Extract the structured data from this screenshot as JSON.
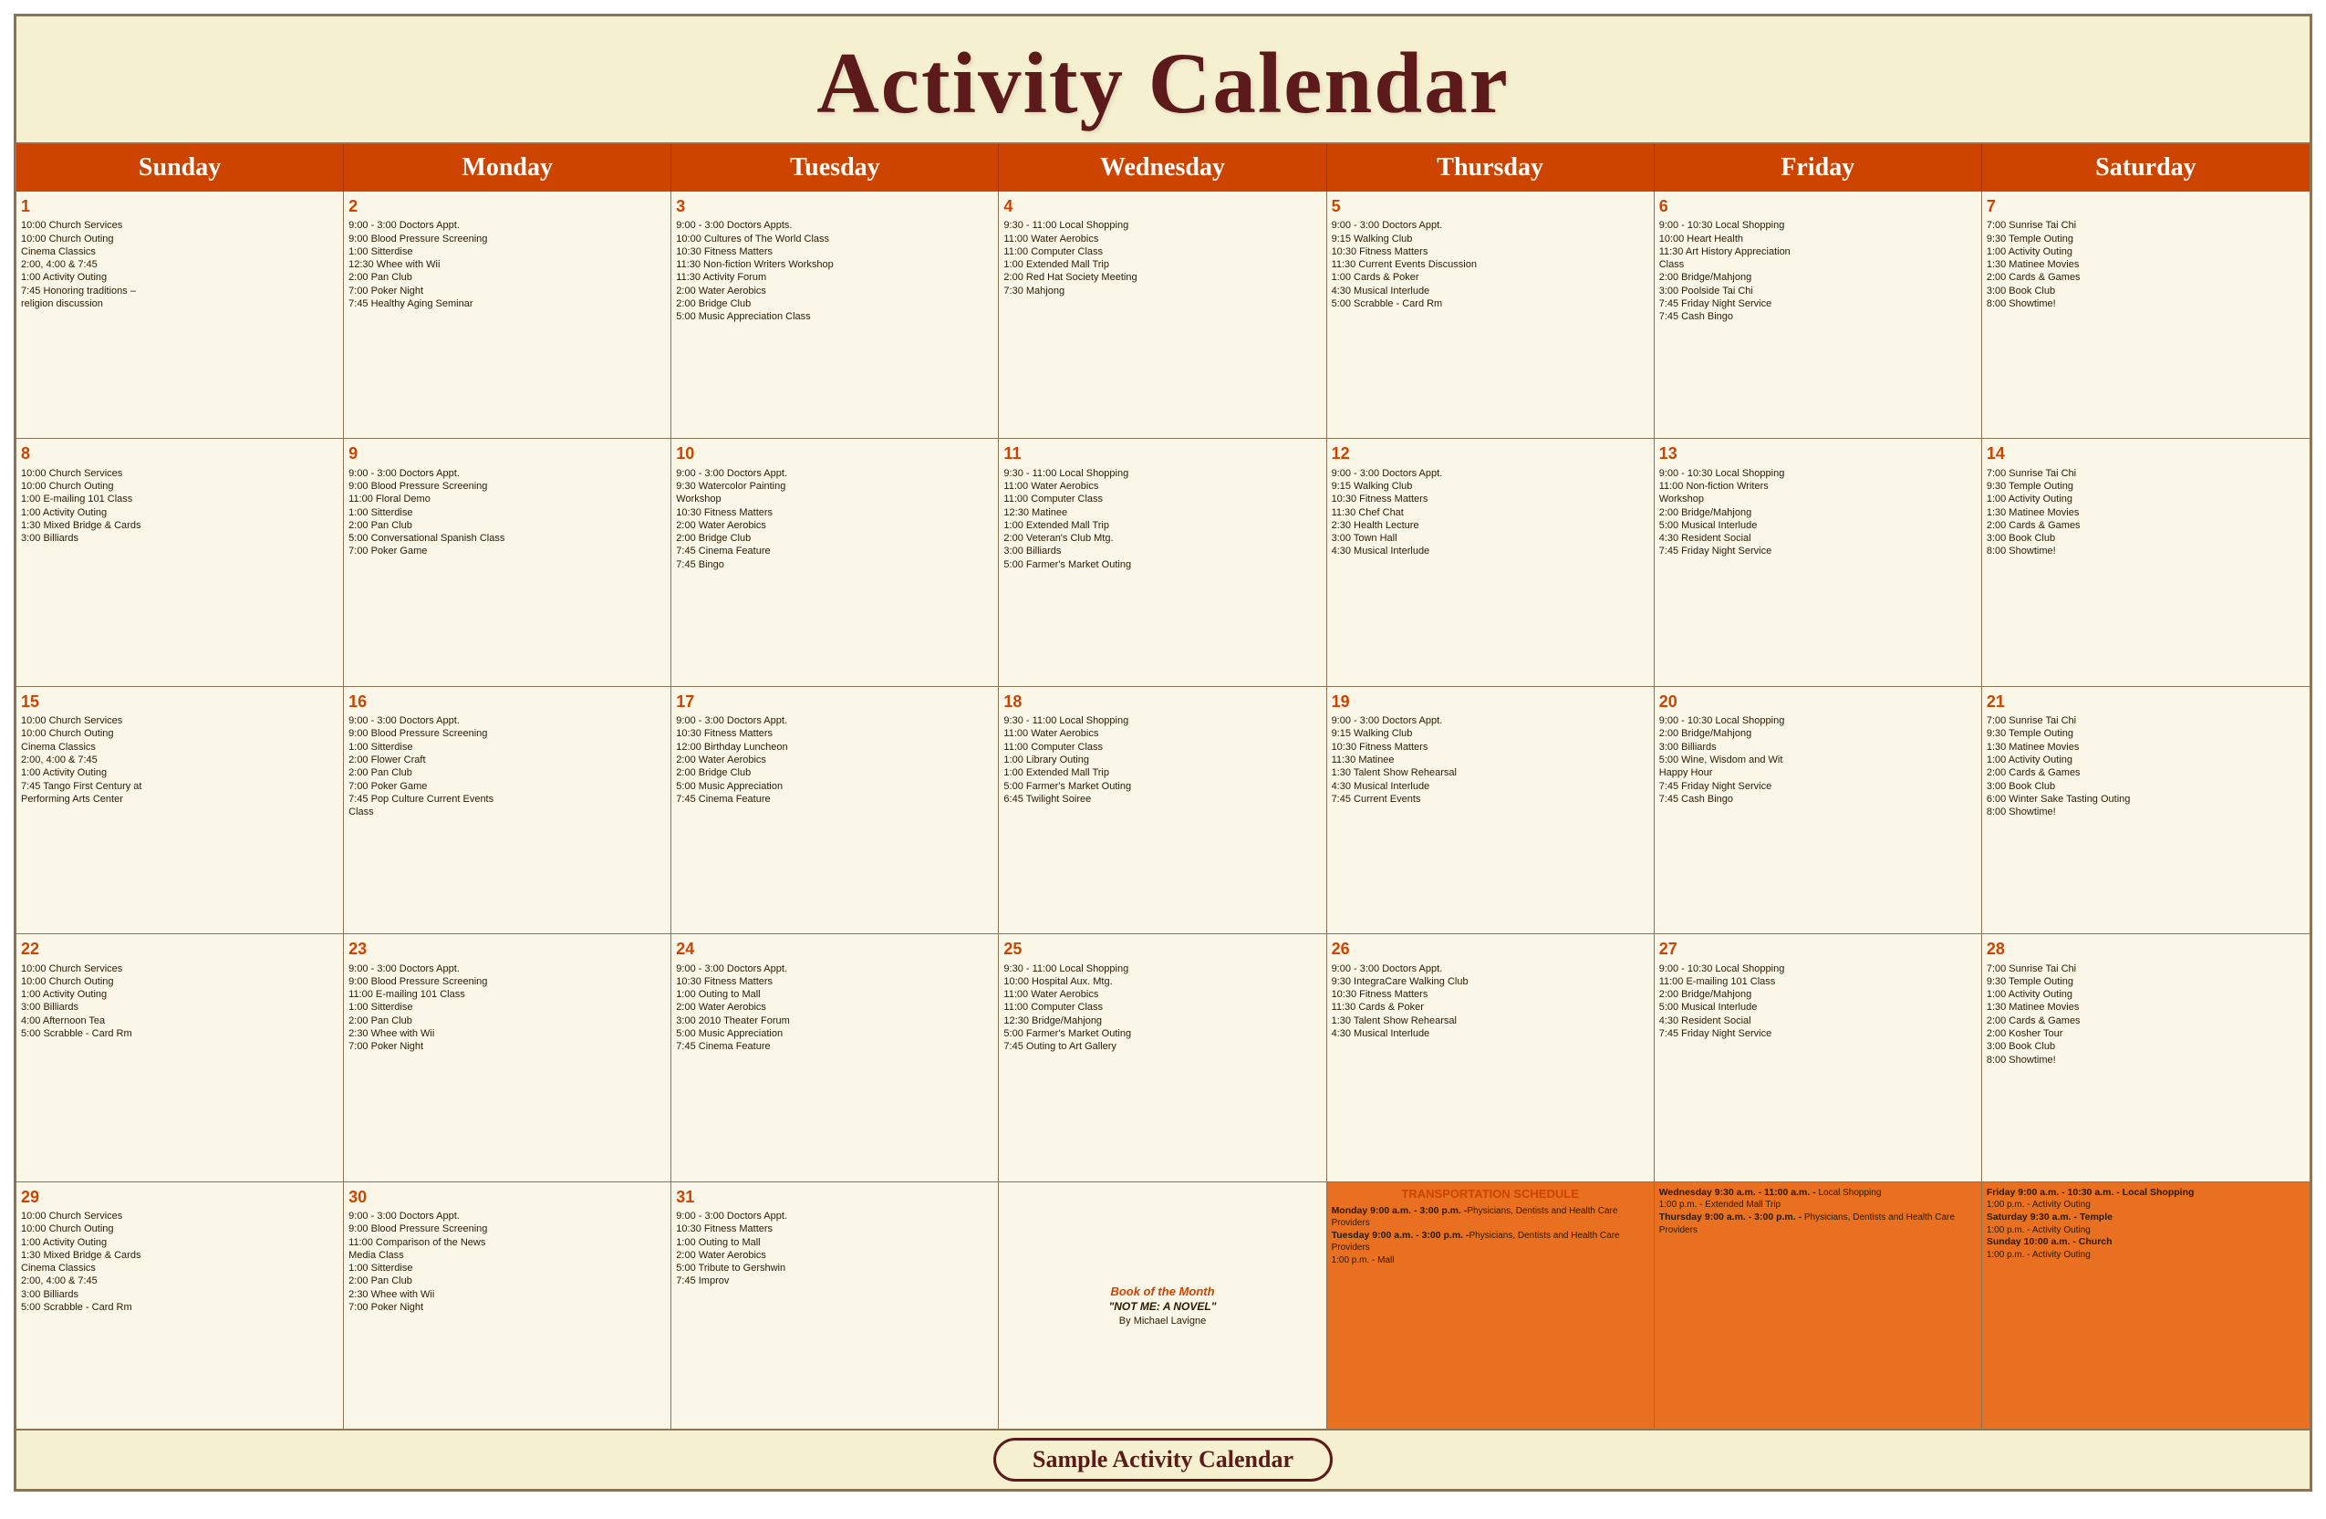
{
  "title": "Activity Calendar",
  "footer": "Sample Activity Calendar",
  "days": [
    "Sunday",
    "Monday",
    "Tuesday",
    "Wednesday",
    "Thursday",
    "Friday",
    "Saturday"
  ],
  "weeks": [
    [
      {
        "num": "1",
        "events": [
          "10:00 Church Services",
          "10:00 Church Outing",
          "Cinema Classics",
          "2:00, 4:00 & 7:45",
          "1:00  Activity Outing",
          "7:45 Honoring traditions –",
          "religion discussion"
        ]
      },
      {
        "num": "2",
        "events": [
          "9:00 - 3:00 Doctors Appt.",
          "9:00 Blood Pressure Screening",
          "1:00 Sitterdise",
          "12:30 Whee with Wii",
          "2:00 Pan Club",
          "7:00 Poker Night",
          "7:45 Healthy Aging Seminar"
        ]
      },
      {
        "num": "3",
        "events": [
          "9:00 - 3:00 Doctors Appts.",
          "10:00 Cultures of The World Class",
          "10:30 Fitness Matters",
          "11:30 Non-fiction Writers Workshop",
          "11:30 Activity Forum",
          "2:00 Water Aerobics",
          "2:00 Bridge Club",
          "5:00 Music Appreciation Class"
        ]
      },
      {
        "num": "4",
        "events": [
          "9:30 - 11:00 Local Shopping",
          "11:00 Water Aerobics",
          "11:00 Computer Class",
          "1:00 Extended Mall Trip",
          "2:00 Red Hat Society Meeting",
          "7:30 Mahjong"
        ]
      },
      {
        "num": "5",
        "events": [
          "9:00 - 3:00 Doctors Appt.",
          "9:15 Walking Club",
          "10:30 Fitness Matters",
          "11:30 Current Events Discussion",
          "1:00 Cards & Poker",
          "4:30 Musical Interlude",
          "5:00 Scrabble - Card Rm"
        ]
      },
      {
        "num": "6",
        "events": [
          "9:00 - 10:30 Local Shopping",
          "10:00 Heart Health",
          "11:30 Art History Appreciation",
          "Class",
          "2:00 Bridge/Mahjong",
          "3:00 Poolside Tai Chi",
          "7:45 Friday Night Service",
          "7:45 Cash Bingo"
        ]
      },
      {
        "num": "7",
        "events": [
          "7:00 Sunrise Tai Chi",
          "9:30 Temple Outing",
          "1:00  Activity Outing",
          "1:30 Matinee Movies",
          "2:00 Cards & Games",
          "3:00 Book Club",
          "8:00 Showtime!"
        ]
      }
    ],
    [
      {
        "num": "8",
        "events": [
          "10:00 Church Services",
          "10:00 Church Outing",
          "1:00 E-mailing 101 Class",
          "1:00  Activity Outing",
          "1:30 Mixed Bridge & Cards",
          "3:00 Billiards"
        ]
      },
      {
        "num": "9",
        "events": [
          "9:00 - 3:00 Doctors Appt.",
          "9:00 Blood Pressure Screening",
          "11:00 Floral Demo",
          "1:00 Sitterdise",
          "2:00 Pan Club",
          "5:00 Conversational Spanish Class",
          "7:00 Poker Game"
        ]
      },
      {
        "num": "10",
        "events": [
          "9:00 - 3:00 Doctors Appt.",
          "9:30 Watercolor Painting",
          "Workshop",
          "10:30 Fitness Matters",
          "2:00 Water Aerobics",
          "2:00 Bridge Club",
          "7:45 Cinema Feature",
          "7:45 Bingo"
        ]
      },
      {
        "num": "11",
        "events": [
          "9:30 - 11:00 Local Shopping",
          "11:00 Water Aerobics",
          "11:00 Computer Class",
          "12:30 Matinee",
          "1:00 Extended Mall Trip",
          "2:00 Veteran's Club Mtg.",
          "3:00 Billiards",
          "5:00 Farmer's Market Outing"
        ]
      },
      {
        "num": "12",
        "events": [
          "9:00 - 3:00 Doctors Appt.",
          "9:15 Walking Club",
          "10:30 Fitness Matters",
          "11:30 Chef Chat",
          "2:30 Health Lecture",
          "3:00 Town Hall",
          "4:30 Musical Interlude"
        ]
      },
      {
        "num": "13",
        "events": [
          "9:00 - 10:30 Local Shopping",
          "11:00 Non-fiction Writers",
          "Workshop",
          "2:00 Bridge/Mahjong",
          "5:00 Musical Interlude",
          "4:30 Resident Social",
          "7:45 Friday Night Service"
        ]
      },
      {
        "num": "14",
        "events": [
          "7:00 Sunrise Tai Chi",
          "9:30 Temple Outing",
          "1:00  Activity Outing",
          "1:30 Matinee Movies",
          "2:00 Cards & Games",
          "3:00 Book Club",
          "8:00 Showtime!"
        ]
      }
    ],
    [
      {
        "num": "15",
        "events": [
          "10:00 Church Services",
          "10:00 Church Outing",
          "Cinema Classics",
          "2:00, 4:00 & 7:45",
          "1:00  Activity Outing",
          "7:45 Tango First Century at",
          "Performing Arts Center"
        ]
      },
      {
        "num": "16",
        "events": [
          "9:00 - 3:00 Doctors Appt.",
          "9:00 Blood Pressure Screening",
          "1:00 Sitterdise",
          "2:00 Flower Craft",
          "2:00 Pan Club",
          "7:00 Poker Game",
          "7:45 Pop Culture Current Events",
          "Class"
        ]
      },
      {
        "num": "17",
        "events": [
          "9:00 - 3:00 Doctors Appt.",
          "10:30 Fitness Matters",
          "12:00 Birthday Luncheon",
          "2:00 Water Aerobics",
          "2:00 Bridge Club",
          "5:00 Music Appreciation",
          "7:45 Cinema Feature"
        ]
      },
      {
        "num": "18",
        "events": [
          "9:30 - 11:00 Local Shopping",
          "11:00 Water Aerobics",
          "11:00 Computer Class",
          "1:00 Library Outing",
          "1:00 Extended Mall Trip",
          "5:00 Farmer's Market Outing",
          "6:45 Twilight Soiree"
        ]
      },
      {
        "num": "19",
        "events": [
          "9:00 - 3:00 Doctors Appt.",
          "9:15 Walking Club",
          "10:30 Fitness Matters",
          "11:30 Matinee",
          "1:30 Talent Show Rehearsal",
          "4:30 Musical Interlude",
          "7:45 Current Events"
        ]
      },
      {
        "num": "20",
        "events": [
          "9:00 - 10:30 Local Shopping",
          "2:00 Bridge/Mahjong",
          "3:00 Billiards",
          "5:00 Wine, Wisdom and Wit",
          "Happy Hour",
          "7:45 Friday Night Service",
          "7:45 Cash Bingo"
        ]
      },
      {
        "num": "21",
        "events": [
          "7:00 Sunrise Tai Chi",
          "9:30 Temple Outing",
          "1:30 Matinee Movies",
          "1:00  Activity Outing",
          "2:00 Cards & Games",
          "3:00 Book Club",
          "6:00 Winter Sake Tasting Outing",
          "8:00 Showtime!"
        ]
      }
    ],
    [
      {
        "num": "22",
        "events": [
          "10:00 Church Services",
          "10:00 Church Outing",
          "1:00  Activity Outing",
          "3:00 Billiards",
          "4:00 Afternoon Tea",
          "5:00 Scrabble - Card Rm"
        ]
      },
      {
        "num": "23",
        "events": [
          "9:00 - 3:00 Doctors Appt.",
          "9:00 Blood Pressure Screening",
          "11:00 E-mailing 101 Class",
          "1:00 Sitterdise",
          "2:00 Pan Club",
          "2:30 Whee with Wii",
          "7:00 Poker Night"
        ]
      },
      {
        "num": "24",
        "events": [
          "9:00 - 3:00 Doctors Appt.",
          "10:30 Fitness Matters",
          "1:00 Outing to Mall",
          "2:00 Water Aerobics",
          "3:00 2010 Theater Forum",
          "5:00 Music Appreciation",
          "7:45 Cinema Feature"
        ]
      },
      {
        "num": "25",
        "events": [
          "9:30 - 11:00 Local Shopping",
          "10:00 Hospital Aux. Mtg.",
          "11:00 Water Aerobics",
          "11:00 Computer Class",
          "12:30 Bridge/Mahjong",
          "5:00 Farmer's Market Outing",
          "7:45 Outing to Art Gallery"
        ]
      },
      {
        "num": "26",
        "events": [
          "9:00 - 3:00 Doctors Appt.",
          "9:30 IntegraCare Walking Club",
          "10:30 Fitness Matters",
          "11:30 Cards & Poker",
          "1:30 Talent Show Rehearsal",
          "4:30 Musical Interlude"
        ]
      },
      {
        "num": "27",
        "events": [
          "9:00 - 10:30 Local Shopping",
          "11:00 E-mailing 101 Class",
          "2:00 Bridge/Mahjong",
          "5:00 Musical Interlude",
          "4:30 Resident Social",
          "7:45 Friday Night Service"
        ]
      },
      {
        "num": "28",
        "events": [
          "7:00 Sunrise Tai Chi",
          "9:30 Temple Outing",
          "1:00  Activity Outing",
          "1:30 Matinee Movies",
          "2:00 Cards & Games",
          "2:00 Kosher Tour",
          "3:00 Book Club",
          "8:00 Showtime!"
        ]
      }
    ],
    [
      {
        "num": "29",
        "events": [
          "10:00 Church Services",
          "10:00 Church Outing",
          "1:00  Activity Outing",
          "1:30 Mixed Bridge & Cards",
          "Cinema Classics",
          "2:00, 4:00 & 7:45",
          "3:00 Billiards",
          "5:00 Scrabble - Card Rm"
        ]
      },
      {
        "num": "30",
        "events": [
          "9:00 - 3:00 Doctors Appt.",
          "9:00 Blood Pressure Screening",
          "11:00 Comparison of the News",
          "Media Class",
          "1:00 Sitterdise",
          "2:00 Pan Club",
          "2:30 Whee with Wii",
          "7:00 Poker Night"
        ]
      },
      {
        "num": "31",
        "events": [
          "9:00 - 3:00 Doctors Appt.",
          "10:30 Fitness Matters",
          "1:00 Outing to Mall",
          "2:00 Water Aerobics",
          "5:00 Tribute to Gershwin",
          "7:45 Improv"
        ]
      },
      {
        "num": "",
        "special": "book",
        "bookTitle": "Book of the Month",
        "bookName": "\"NOT ME: A NOVEL\"",
        "bookAuthor": "By Michael Lavigne"
      },
      {
        "num": "",
        "special": "transport_thu",
        "transportData": [
          {
            "day": "Monday 9:00 a.m. - 3:00 p.m. -",
            "text": "Physicians, Dentists and Health Care Providers"
          },
          {
            "day": "Tuesday 9:00 a.m. - 3:00 p.m. -",
            "text": "Physicians, Dentists and Health Care Providers"
          },
          {
            "day": "",
            "text": "1:00 p.m. - Mall"
          }
        ]
      },
      {
        "num": "",
        "special": "transport_fri",
        "transportData": [
          {
            "day": "Wednesday 9:30 a.m. - 11:00 a.m. -",
            "text": "Local Shopping"
          },
          {
            "day": "",
            "text": "1:00 p.m. - Extended Mall Trip"
          },
          {
            "day": "Thursday 9:00 a.m. - 3:00 p.m. -",
            "text": "Physicians, Dentists and Health Care Providers"
          }
        ]
      },
      {
        "num": "",
        "special": "transport_sat",
        "transportData": [
          {
            "day": "Friday 9:00 a.m. - 10:30 a.m. - Local Shopping",
            "text": ""
          },
          {
            "day": "",
            "text": "1:00 p.m. - Activity Outing"
          },
          {
            "day": "Saturday 9:30 a.m. - Temple",
            "text": ""
          },
          {
            "day": "",
            "text": "1:00 p.m. - Activity Outing"
          },
          {
            "day": "Sunday 10:00 a.m. - Church",
            "text": ""
          },
          {
            "day": "",
            "text": "1:00 p.m. - Activity Outing"
          }
        ]
      }
    ]
  ]
}
